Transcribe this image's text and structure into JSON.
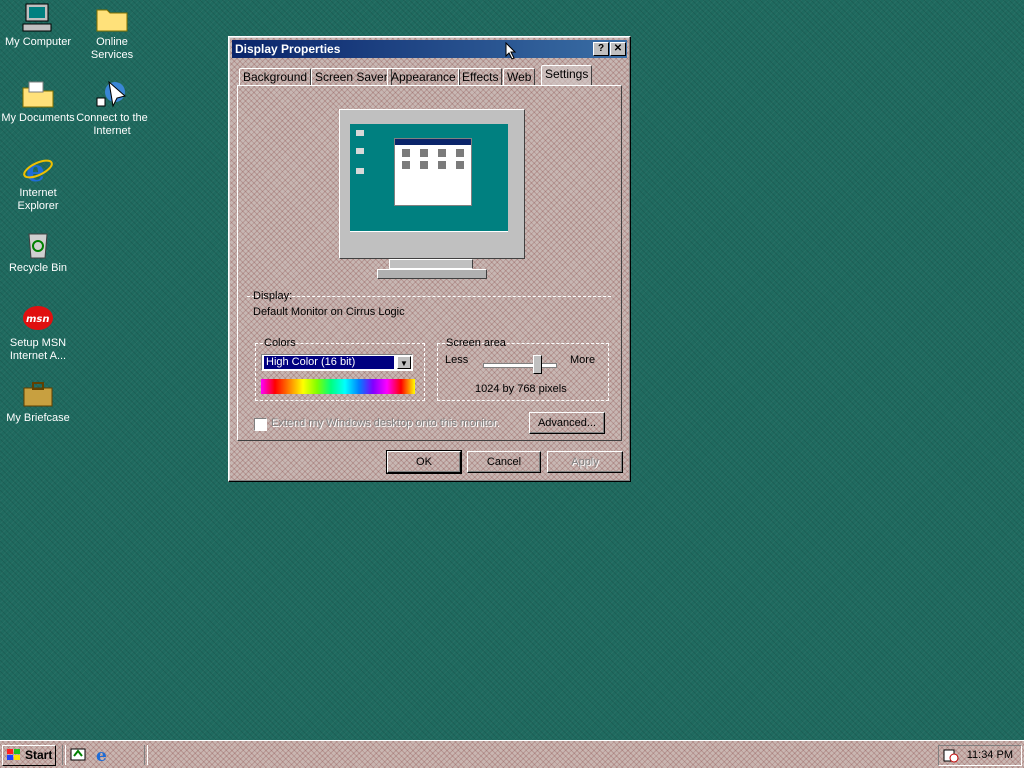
{
  "desktop": {
    "icons": [
      {
        "label": "My Computer"
      },
      {
        "label": "Online Services"
      },
      {
        "label": "My Documents"
      },
      {
        "label": "Connect to the Internet"
      },
      {
        "label": "Internet Explorer"
      },
      {
        "label": "Recycle Bin"
      },
      {
        "label": "Setup MSN Internet A..."
      },
      {
        "label": "My Briefcase"
      }
    ]
  },
  "dialog": {
    "title": "Display Properties",
    "help_btn": "?",
    "close_btn": "✕",
    "tabs": [
      "Background",
      "Screen Saver",
      "Appearance",
      "Effects",
      "Web",
      "Settings"
    ],
    "active_tab": "Settings",
    "display_label": "Display:",
    "display_value": "Default Monitor on Cirrus Logic",
    "colors": {
      "title": "Colors",
      "selected": "High Color (16 bit)"
    },
    "screen_area": {
      "title": "Screen area",
      "less": "Less",
      "more": "More",
      "value": "1024 by 768 pixels",
      "slider_fraction": 0.75
    },
    "extend_checkbox": "Extend my Windows desktop onto this monitor.",
    "advanced_btn": "Advanced...",
    "ok_btn": "OK",
    "cancel_btn": "Cancel",
    "apply_btn": "Apply"
  },
  "taskbar": {
    "start": "Start",
    "quick_launch": [
      "show-desktop-icon",
      "ie-icon"
    ],
    "clock": "11:34 PM"
  },
  "colors": {
    "desktop": "#1f6a5f",
    "titlebar": "#0a246a",
    "selection": "#000080"
  }
}
